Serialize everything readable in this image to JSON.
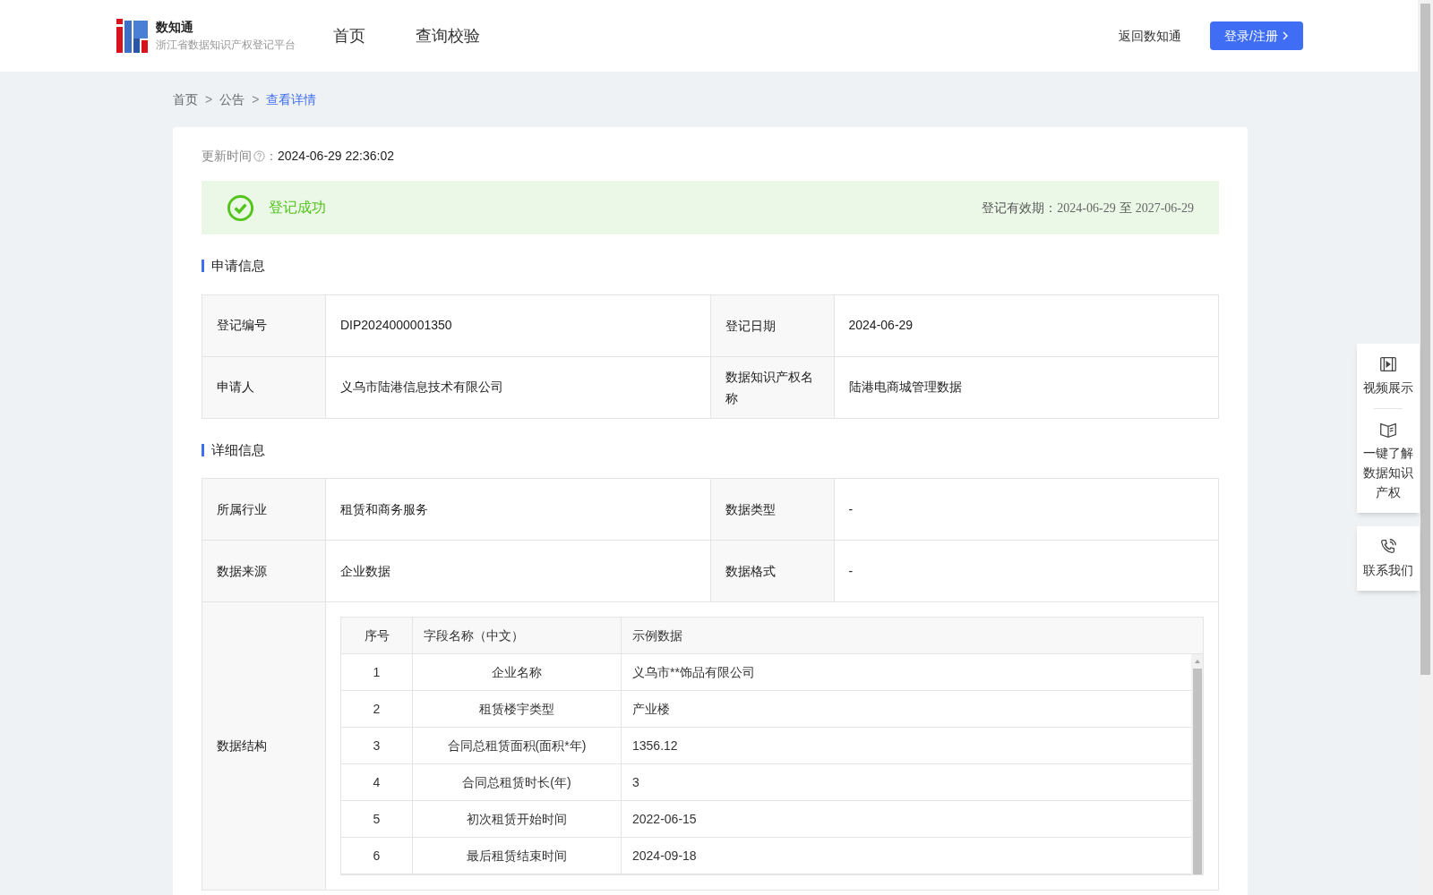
{
  "header": {
    "brand": "数知通",
    "subtitle": "浙江省数据知识产权登记平台",
    "nav": [
      {
        "label": "首页",
        "selected": false
      },
      {
        "label": "查询校验",
        "selected": false
      }
    ],
    "back_link": "返回数知通",
    "login_button": "登录/注册"
  },
  "breadcrumb": [
    {
      "label": "首页",
      "current": false
    },
    {
      "label": "公告",
      "current": false
    },
    {
      "label": "查看详情",
      "current": true
    }
  ],
  "breadcrumb_separator": ">",
  "update": {
    "label": "更新时间",
    "colon": "：",
    "value": "2024-06-29 22:36:02"
  },
  "status": {
    "text": "登记成功",
    "validity_label": "登记有效期：",
    "validity_start": "2024-06-29",
    "validity_sep": "至",
    "validity_end": "2027-06-29"
  },
  "application": {
    "title": "申请信息",
    "rows": [
      {
        "label1": "登记编号",
        "value1": "DIP2024000001350",
        "label2": "登记日期",
        "value2": "2024-06-29"
      },
      {
        "label1": "申请人",
        "value1": "义乌市陆港信息技术有限公司",
        "label2": "数据知识产权名称",
        "value2": "陆港电商城管理数据"
      }
    ]
  },
  "details": {
    "title": "详细信息",
    "rows": [
      {
        "label1": "所属行业",
        "value1": "租赁和商务服务",
        "label2": "数据类型",
        "value2": "-"
      },
      {
        "label1": "数据来源",
        "value1": "企业数据",
        "label2": "数据格式",
        "value2": "-"
      }
    ],
    "structure": {
      "label": "数据结构",
      "columns": [
        "序号",
        "字段名称（中文）",
        "示例数据"
      ],
      "rows": [
        [
          "1",
          "企业名称",
          "义乌市**饰品有限公司"
        ],
        [
          "2",
          "租赁楼宇类型",
          "产业楼"
        ],
        [
          "3",
          "合同总租赁面积(面积*年)",
          "1356.12"
        ],
        [
          "4",
          "合同总租赁时长(年)",
          "3"
        ],
        [
          "5",
          "初次租赁开始时间",
          "2022-06-15"
        ],
        [
          "6",
          "最后租赁结束时间",
          "2024-09-18"
        ]
      ]
    }
  },
  "side_widget": [
    {
      "kind": "video",
      "label": "视频展示"
    },
    {
      "kind": "book",
      "label": "一键了解数据知识产权"
    },
    {
      "kind": "phone",
      "label": "联系我们"
    }
  ]
}
